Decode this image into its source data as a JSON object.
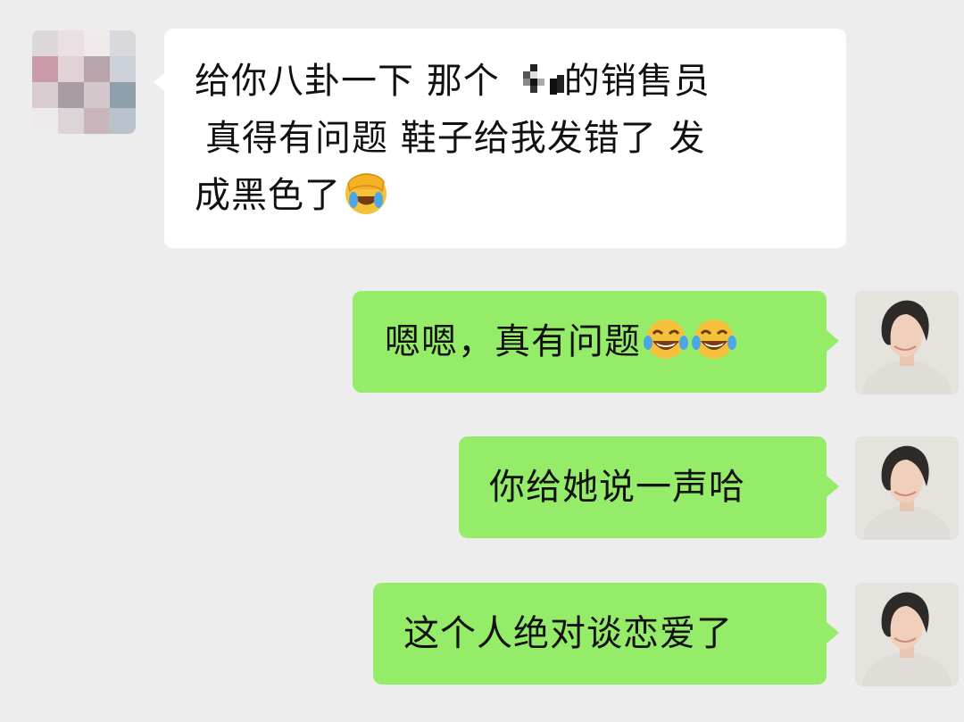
{
  "conversation": {
    "incoming": {
      "lines": [
        "给你八卦一下 那个",
        "的销售员",
        "真得有问题 鞋子给我发错了 发",
        "成黑色了"
      ],
      "emoji": "face-palm-emoji"
    },
    "outgoing": [
      {
        "text": "嗯嗯，真有问题",
        "emoji": "tears-of-joy-emoji"
      },
      {
        "text": "你给她说一声哈"
      },
      {
        "text": "这个人绝对谈恋爱了"
      }
    ]
  },
  "colors": {
    "background": "#ededed",
    "incoming_bubble": "#ffffff",
    "outgoing_bubble": "#95ec69",
    "text": "#111111"
  }
}
